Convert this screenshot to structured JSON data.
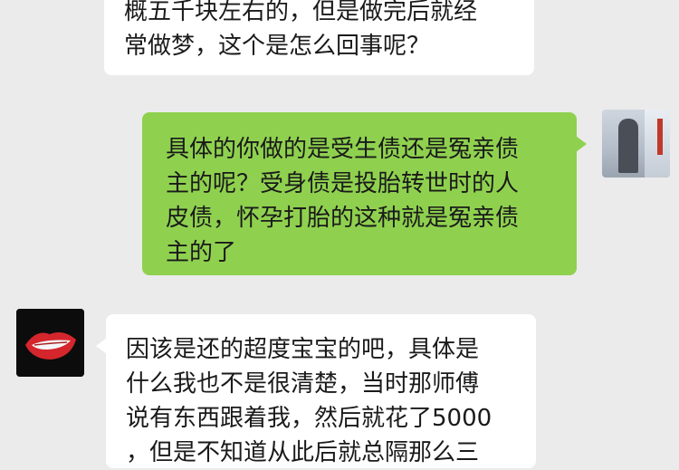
{
  "chat": {
    "messages": [
      {
        "sender": "other",
        "lines": [
          "概五千块左右的，但是做完后就经",
          "常做梦，这个是怎么回事呢？"
        ]
      },
      {
        "sender": "self",
        "lines": [
          "具体的你做的是受生债还是冤亲债",
          "主的呢？受身债是投胎转世时的人",
          "皮债，怀孕打胎的这种就是冤亲债",
          "主的了"
        ]
      },
      {
        "sender": "other",
        "lines": [
          "因该是还的超度宝宝的吧，具体是",
          "什么我也不是很清楚，当时那师傅",
          "说有东西跟着我，然后就花了5000",
          "，但是不知道从此后就总隔那么三"
        ]
      }
    ]
  },
  "avatars": {
    "self": {
      "icon": "photo-avatar-icon"
    },
    "other": {
      "icon": "red-lips-avatar-icon"
    }
  },
  "colors": {
    "background": "#ebebeb",
    "bubble_in": "#ffffff",
    "bubble_out": "#8fd14f",
    "text": "#1a1a1a",
    "lips": "#d4262c"
  }
}
